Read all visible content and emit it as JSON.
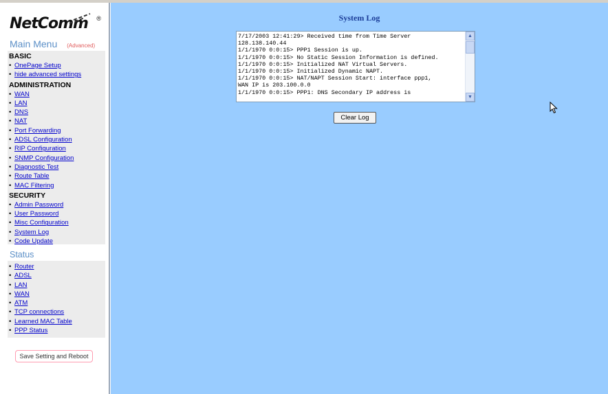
{
  "brand": {
    "logo_text": "NetComm",
    "registered": "®"
  },
  "sidebar": {
    "main_menu_title": "Main Menu",
    "advanced_badge": "(Advanced)",
    "sections": [
      {
        "heading": "BASIC",
        "items": [
          "OnePage Setup",
          "hide advanced settings"
        ]
      },
      {
        "heading": "ADMINISTRATION",
        "items": [
          "WAN",
          "LAN",
          "DNS",
          "NAT",
          "Port Forwarding",
          "ADSL Configuration",
          "RIP Configuration",
          "SNMP Configuration",
          "Diagnostic Test",
          "Route Table",
          "MAC Filtering"
        ]
      },
      {
        "heading": "SECURITY",
        "items": [
          "Admin Password",
          "User Password",
          "Misc Configuration",
          "System Log",
          "Code Update"
        ]
      }
    ],
    "status_title": "Status",
    "status_items": [
      "Router",
      "ADSL",
      "LAN",
      "WAN",
      "ATM",
      "TCP connections",
      "Learned MAC Table",
      "PPP Status"
    ],
    "save_button": "Save Setting and Reboot"
  },
  "main": {
    "title": "System Log",
    "log_lines": [
      "7/17/2003 12:41:29> Received time from Time Server",
      "128.138.140.44",
      "1/1/1970 0:0:15> PPP1 Session is up.",
      "1/1/1970 0:0:15> No Static Session Information is defined.",
      "1/1/1970 0:0:15> Initialized NAT Virtual Servers.",
      "1/1/1970 0:0:15> Initialized Dynamic NAPT.",
      "1/1/1970 0:0:15> NAT/NAPT Session Start: interface ppp1,",
      "WAN IP is 203.100.0.0",
      "1/1/1970 0:0:15> PPP1: DNS Secondary IP address is"
    ],
    "clear_button": "Clear Log"
  },
  "colors": {
    "main_bg": "#99ccff",
    "link": "#0000cc",
    "title": "#1a3c98",
    "menu_title": "#5b8fc7"
  }
}
